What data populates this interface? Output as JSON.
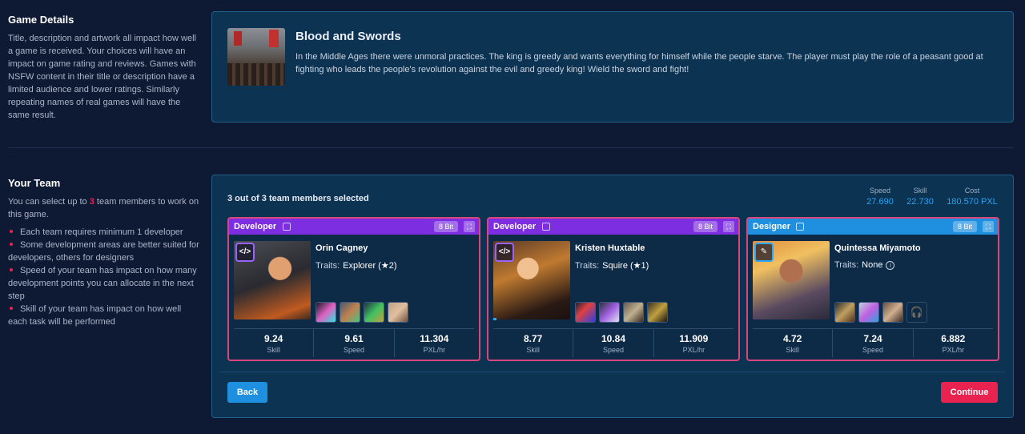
{
  "game_details": {
    "section_title": "Game Details",
    "section_desc": "Title, description and artwork all impact how well a game is received. Your choices will have an impact on game rating and reviews. Games with NSFW content in their title or description have a limited audience and lower ratings. Similarly repeating names of real games will have the same result.",
    "title": "Blood and Swords",
    "description": "In the Middle Ages there were unmoral practices. The king is greedy and wants everything for himself while the people starve. The player must play the role of a peasant good at fighting who leads the people's revolution against the evil and greedy king! Wield the sword and fight!"
  },
  "your_team": {
    "section_title": "Your Team",
    "intro_before": "You can select up to ",
    "intro_count": "3",
    "intro_after": " team members to work on this game.",
    "bullets": [
      "Each team requires minimum 1 developer",
      "Some development areas are better suited for developers, others for designers",
      "Speed of your team has impact on how many development points you can allocate in the next step",
      "Skill of your team has impact on how well each task will be performed"
    ],
    "selected_text": "3 out of 3 team members selected",
    "totals": {
      "speed_label": "Speed",
      "speed_value": "27.690",
      "skill_label": "Skill",
      "skill_value": "22.730",
      "cost_label": "Cost",
      "cost_value": "180.570 PXL"
    },
    "members": [
      {
        "role": "Developer",
        "badge": "8 Bit",
        "name": "Orin Cagney",
        "traits_label": "Traits:",
        "traits_value": "Explorer (★2)",
        "skill": "9.24",
        "speed": "9.61",
        "rate": "11.304",
        "skill_label": "Skill",
        "speed_label": "Speed",
        "rate_label": "PXL/hr"
      },
      {
        "role": "Developer",
        "badge": "8 Bit",
        "name": "Kristen Huxtable",
        "traits_label": "Traits:",
        "traits_value": "Squire (★1)",
        "skill": "8.77",
        "speed": "10.84",
        "rate": "11.909",
        "skill_label": "Skill",
        "speed_label": "Speed",
        "rate_label": "PXL/hr"
      },
      {
        "role": "Designer",
        "badge": "8 Bit",
        "name": "Quintessa Miyamoto",
        "traits_label": "Traits:",
        "traits_value": "None",
        "skill": "4.72",
        "speed": "7.24",
        "rate": "6.882",
        "skill_label": "Skill",
        "speed_label": "Speed",
        "rate_label": "PXL/hr"
      }
    ],
    "back_label": "Back",
    "continue_label": "Continue"
  },
  "colors": {
    "accent_blue": "#1f8fe0",
    "accent_red": "#e8234f",
    "developer_purple": "#7d2ee0",
    "card_border": "#d9467b"
  }
}
